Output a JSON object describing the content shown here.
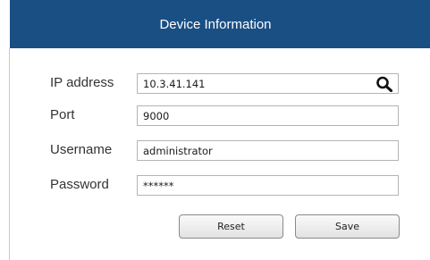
{
  "header": {
    "title": "Device Information"
  },
  "form": {
    "ip": {
      "label": "IP address",
      "value": "10.3.41.141"
    },
    "port": {
      "label": "Port",
      "value": "9000"
    },
    "username": {
      "label": "Username",
      "value": "administrator"
    },
    "password": {
      "label": "Password",
      "value": "******"
    }
  },
  "buttons": {
    "reset": "Reset",
    "save": "Save"
  },
  "colors": {
    "header_bg": "#1a4f84",
    "header_text": "#ffffff"
  },
  "icons": {
    "search": "search-icon"
  }
}
